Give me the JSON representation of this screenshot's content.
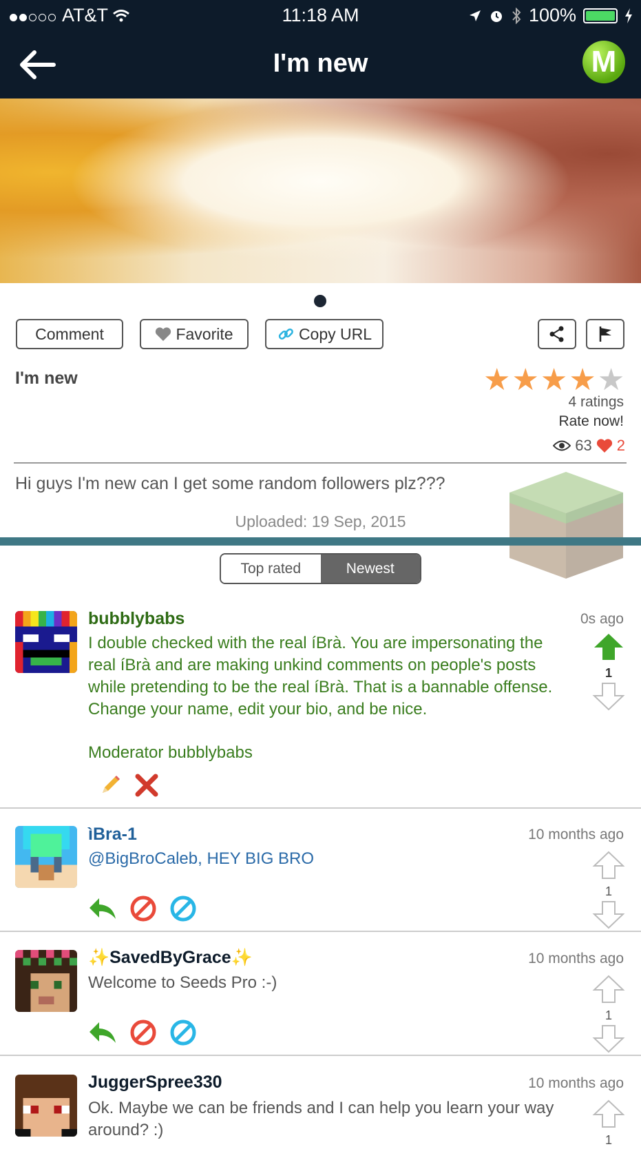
{
  "status": {
    "carrier": "AT&T",
    "time": "11:18 AM",
    "battery": "100%"
  },
  "nav": {
    "title": "I'm new",
    "logo_letter": "M"
  },
  "actions": {
    "comment": "Comment",
    "favorite": "Favorite",
    "copy_url": "Copy URL"
  },
  "post": {
    "title": "I'm new",
    "rating_stars": 4,
    "ratings_label": "4 ratings",
    "rate_now": "Rate now!",
    "views": "63",
    "likes": "2",
    "description": "Hi guys I'm new can I get some random followers plz???",
    "uploaded": "Uploaded: 19 Sep, 2015"
  },
  "sort": {
    "top_rated": "Top rated",
    "newest": "Newest"
  },
  "comments": [
    {
      "name": "bubblybabs",
      "time": "0s ago",
      "text": "I double checked with the real íBrà. You are impersonating the real íBrà and are making unkind comments on people's posts while pretending to be the real íBrà. That is a bannable offense. Change your name, edit your bio, and be nice.",
      "signature": "Moderator bubblybabs",
      "votes": "1"
    },
    {
      "name": "ìBra-1",
      "time": "10 months ago",
      "text": "@BigBroCaleb, HEY BIG BRO",
      "votes": "1"
    },
    {
      "name": "✨SavedByGrace✨",
      "time": "10 months ago",
      "text": "Welcome to Seeds Pro :-)",
      "votes": "1"
    },
    {
      "name": "JuggerSpree330",
      "time": "10 months ago",
      "text": "Ok. Maybe we can be friends and I can help you learn your way around? :)",
      "votes": "1"
    }
  ],
  "colors": {
    "nav_bg": "#0d1b2a",
    "moderator_text": "#3a7d1e",
    "accent_teal": "#3f7885",
    "star": "#f79d4a",
    "heart": "#e94a3a"
  }
}
